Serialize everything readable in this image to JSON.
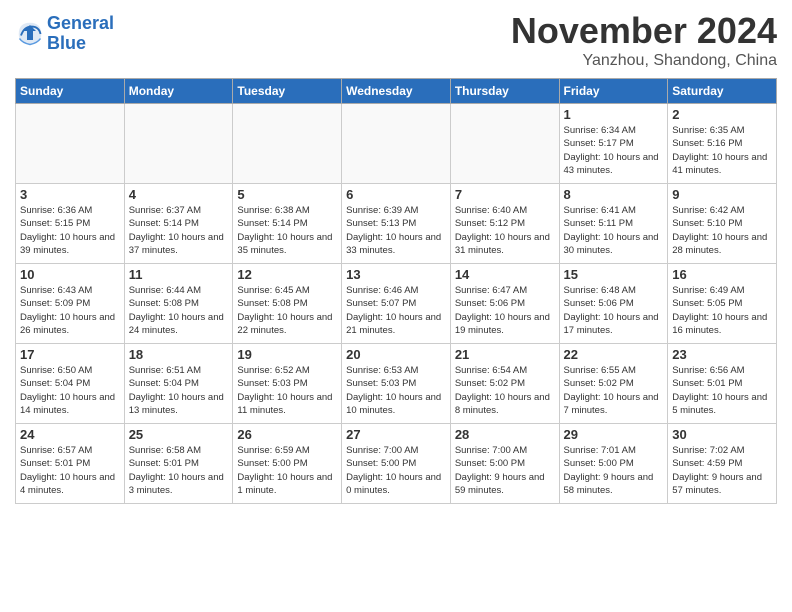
{
  "header": {
    "logo_line1": "General",
    "logo_line2": "Blue",
    "month": "November 2024",
    "location": "Yanzhou, Shandong, China"
  },
  "weekdays": [
    "Sunday",
    "Monday",
    "Tuesday",
    "Wednesday",
    "Thursday",
    "Friday",
    "Saturday"
  ],
  "weeks": [
    [
      {
        "day": "",
        "info": ""
      },
      {
        "day": "",
        "info": ""
      },
      {
        "day": "",
        "info": ""
      },
      {
        "day": "",
        "info": ""
      },
      {
        "day": "",
        "info": ""
      },
      {
        "day": "1",
        "info": "Sunrise: 6:34 AM\nSunset: 5:17 PM\nDaylight: 10 hours and 43 minutes."
      },
      {
        "day": "2",
        "info": "Sunrise: 6:35 AM\nSunset: 5:16 PM\nDaylight: 10 hours and 41 minutes."
      }
    ],
    [
      {
        "day": "3",
        "info": "Sunrise: 6:36 AM\nSunset: 5:15 PM\nDaylight: 10 hours and 39 minutes."
      },
      {
        "day": "4",
        "info": "Sunrise: 6:37 AM\nSunset: 5:14 PM\nDaylight: 10 hours and 37 minutes."
      },
      {
        "day": "5",
        "info": "Sunrise: 6:38 AM\nSunset: 5:14 PM\nDaylight: 10 hours and 35 minutes."
      },
      {
        "day": "6",
        "info": "Sunrise: 6:39 AM\nSunset: 5:13 PM\nDaylight: 10 hours and 33 minutes."
      },
      {
        "day": "7",
        "info": "Sunrise: 6:40 AM\nSunset: 5:12 PM\nDaylight: 10 hours and 31 minutes."
      },
      {
        "day": "8",
        "info": "Sunrise: 6:41 AM\nSunset: 5:11 PM\nDaylight: 10 hours and 30 minutes."
      },
      {
        "day": "9",
        "info": "Sunrise: 6:42 AM\nSunset: 5:10 PM\nDaylight: 10 hours and 28 minutes."
      }
    ],
    [
      {
        "day": "10",
        "info": "Sunrise: 6:43 AM\nSunset: 5:09 PM\nDaylight: 10 hours and 26 minutes."
      },
      {
        "day": "11",
        "info": "Sunrise: 6:44 AM\nSunset: 5:08 PM\nDaylight: 10 hours and 24 minutes."
      },
      {
        "day": "12",
        "info": "Sunrise: 6:45 AM\nSunset: 5:08 PM\nDaylight: 10 hours and 22 minutes."
      },
      {
        "day": "13",
        "info": "Sunrise: 6:46 AM\nSunset: 5:07 PM\nDaylight: 10 hours and 21 minutes."
      },
      {
        "day": "14",
        "info": "Sunrise: 6:47 AM\nSunset: 5:06 PM\nDaylight: 10 hours and 19 minutes."
      },
      {
        "day": "15",
        "info": "Sunrise: 6:48 AM\nSunset: 5:06 PM\nDaylight: 10 hours and 17 minutes."
      },
      {
        "day": "16",
        "info": "Sunrise: 6:49 AM\nSunset: 5:05 PM\nDaylight: 10 hours and 16 minutes."
      }
    ],
    [
      {
        "day": "17",
        "info": "Sunrise: 6:50 AM\nSunset: 5:04 PM\nDaylight: 10 hours and 14 minutes."
      },
      {
        "day": "18",
        "info": "Sunrise: 6:51 AM\nSunset: 5:04 PM\nDaylight: 10 hours and 13 minutes."
      },
      {
        "day": "19",
        "info": "Sunrise: 6:52 AM\nSunset: 5:03 PM\nDaylight: 10 hours and 11 minutes."
      },
      {
        "day": "20",
        "info": "Sunrise: 6:53 AM\nSunset: 5:03 PM\nDaylight: 10 hours and 10 minutes."
      },
      {
        "day": "21",
        "info": "Sunrise: 6:54 AM\nSunset: 5:02 PM\nDaylight: 10 hours and 8 minutes."
      },
      {
        "day": "22",
        "info": "Sunrise: 6:55 AM\nSunset: 5:02 PM\nDaylight: 10 hours and 7 minutes."
      },
      {
        "day": "23",
        "info": "Sunrise: 6:56 AM\nSunset: 5:01 PM\nDaylight: 10 hours and 5 minutes."
      }
    ],
    [
      {
        "day": "24",
        "info": "Sunrise: 6:57 AM\nSunset: 5:01 PM\nDaylight: 10 hours and 4 minutes."
      },
      {
        "day": "25",
        "info": "Sunrise: 6:58 AM\nSunset: 5:01 PM\nDaylight: 10 hours and 3 minutes."
      },
      {
        "day": "26",
        "info": "Sunrise: 6:59 AM\nSunset: 5:00 PM\nDaylight: 10 hours and 1 minute."
      },
      {
        "day": "27",
        "info": "Sunrise: 7:00 AM\nSunset: 5:00 PM\nDaylight: 10 hours and 0 minutes."
      },
      {
        "day": "28",
        "info": "Sunrise: 7:00 AM\nSunset: 5:00 PM\nDaylight: 9 hours and 59 minutes."
      },
      {
        "day": "29",
        "info": "Sunrise: 7:01 AM\nSunset: 5:00 PM\nDaylight: 9 hours and 58 minutes."
      },
      {
        "day": "30",
        "info": "Sunrise: 7:02 AM\nSunset: 4:59 PM\nDaylight: 9 hours and 57 minutes."
      }
    ]
  ]
}
